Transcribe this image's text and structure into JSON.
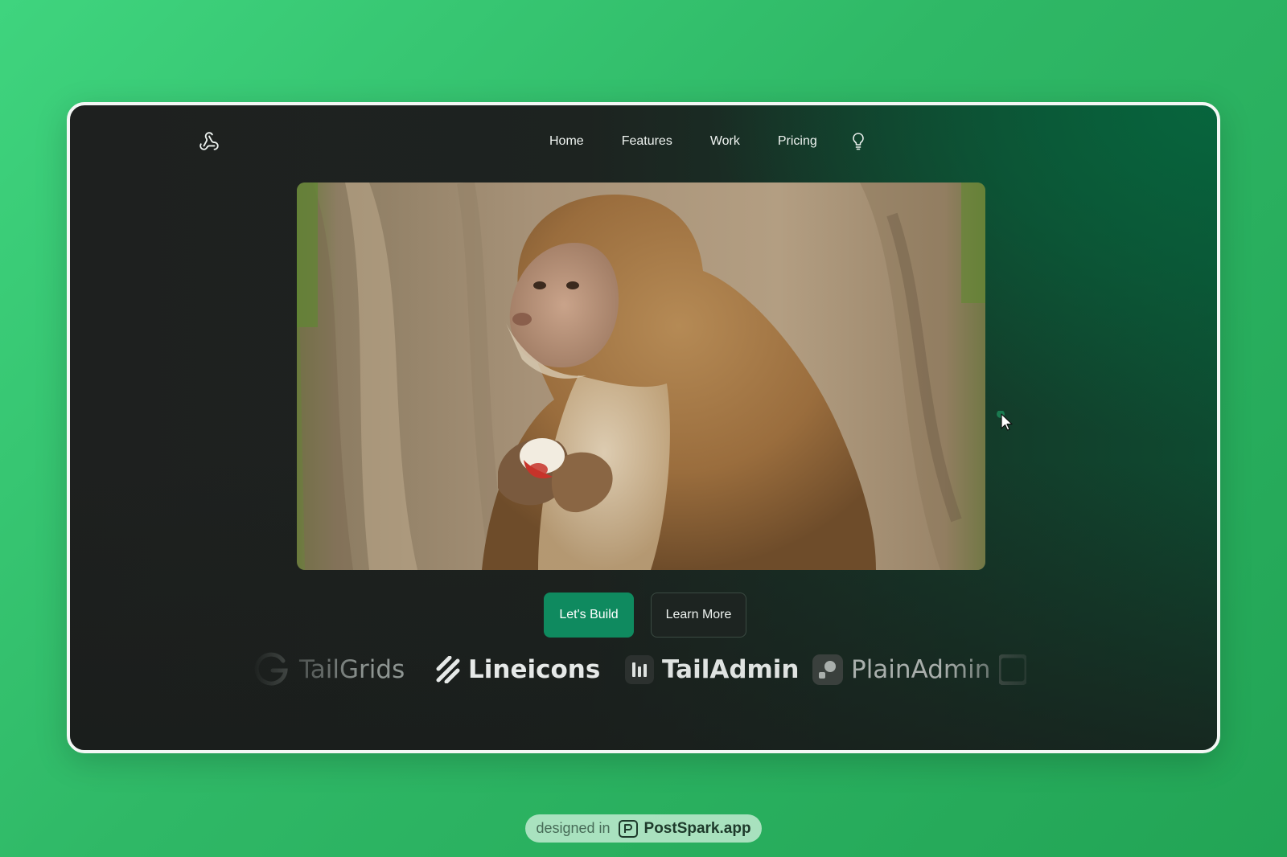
{
  "nav": {
    "logo_icon": "webhook-icon",
    "items": [
      {
        "label": "Home"
      },
      {
        "label": "Features"
      },
      {
        "label": "Work"
      },
      {
        "label": "Pricing"
      }
    ],
    "theme_icon": "lightbulb-icon"
  },
  "hero": {
    "image_subject": "monkey-photo"
  },
  "actions": {
    "primary_label": "Let's Build",
    "secondary_label": "Learn More"
  },
  "brands": [
    {
      "name": "TailGrids",
      "icon": "tailgrids-logo-icon"
    },
    {
      "name": "Lineicons",
      "icon": "lineicons-logo-icon"
    },
    {
      "name": "TailAdmin",
      "icon": "tailadmin-logo-icon"
    },
    {
      "name": "PlainAdmin",
      "icon": "plainadmin-logo-icon"
    }
  ],
  "footer_badge": {
    "prefix": "designed in",
    "brand": "PostSpark.app",
    "icon": "postspark-logo-icon"
  },
  "colors": {
    "accent": "#0f8a5f",
    "background_outer": "#2fb866",
    "frame_dark": "#1e201f",
    "frame_green": "#07653d"
  }
}
